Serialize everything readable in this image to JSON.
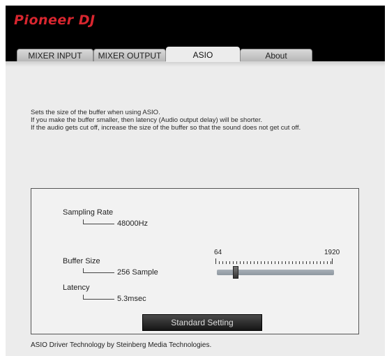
{
  "app": {
    "brand": "Pioneer DJ"
  },
  "tabs": [
    {
      "label": "MIXER INPUT",
      "active": false
    },
    {
      "label": "MIXER OUTPUT",
      "active": false
    },
    {
      "label": "ASIO",
      "active": true
    },
    {
      "label": "About",
      "active": false
    }
  ],
  "description": [
    "Sets the size of the buffer when using ASIO.",
    "If you make the buffer smaller, then latency (Audio output delay) will be shorter.",
    "If the audio gets cut off, increase the size of the buffer so that the sound does not get cut off."
  ],
  "settings": {
    "sampling_rate_label": "Sampling Rate",
    "sampling_rate_value": "48000Hz",
    "buffer_size_label": "Buffer Size",
    "buffer_size_value": "256 Sample",
    "latency_label": "Latency",
    "latency_value": "5.3msec",
    "slider_min_label": "64",
    "slider_max_label": "1920",
    "slider_min": 64,
    "slider_max": 1920,
    "slider_value": 256,
    "standard_button_label": "Standard Setting"
  },
  "footer": "ASIO Driver Technology by Steinberg Media Technologies.",
  "colors": {
    "brand_red": "#d8262f",
    "header_bg": "#000000",
    "panel_bg": "#ececec"
  }
}
